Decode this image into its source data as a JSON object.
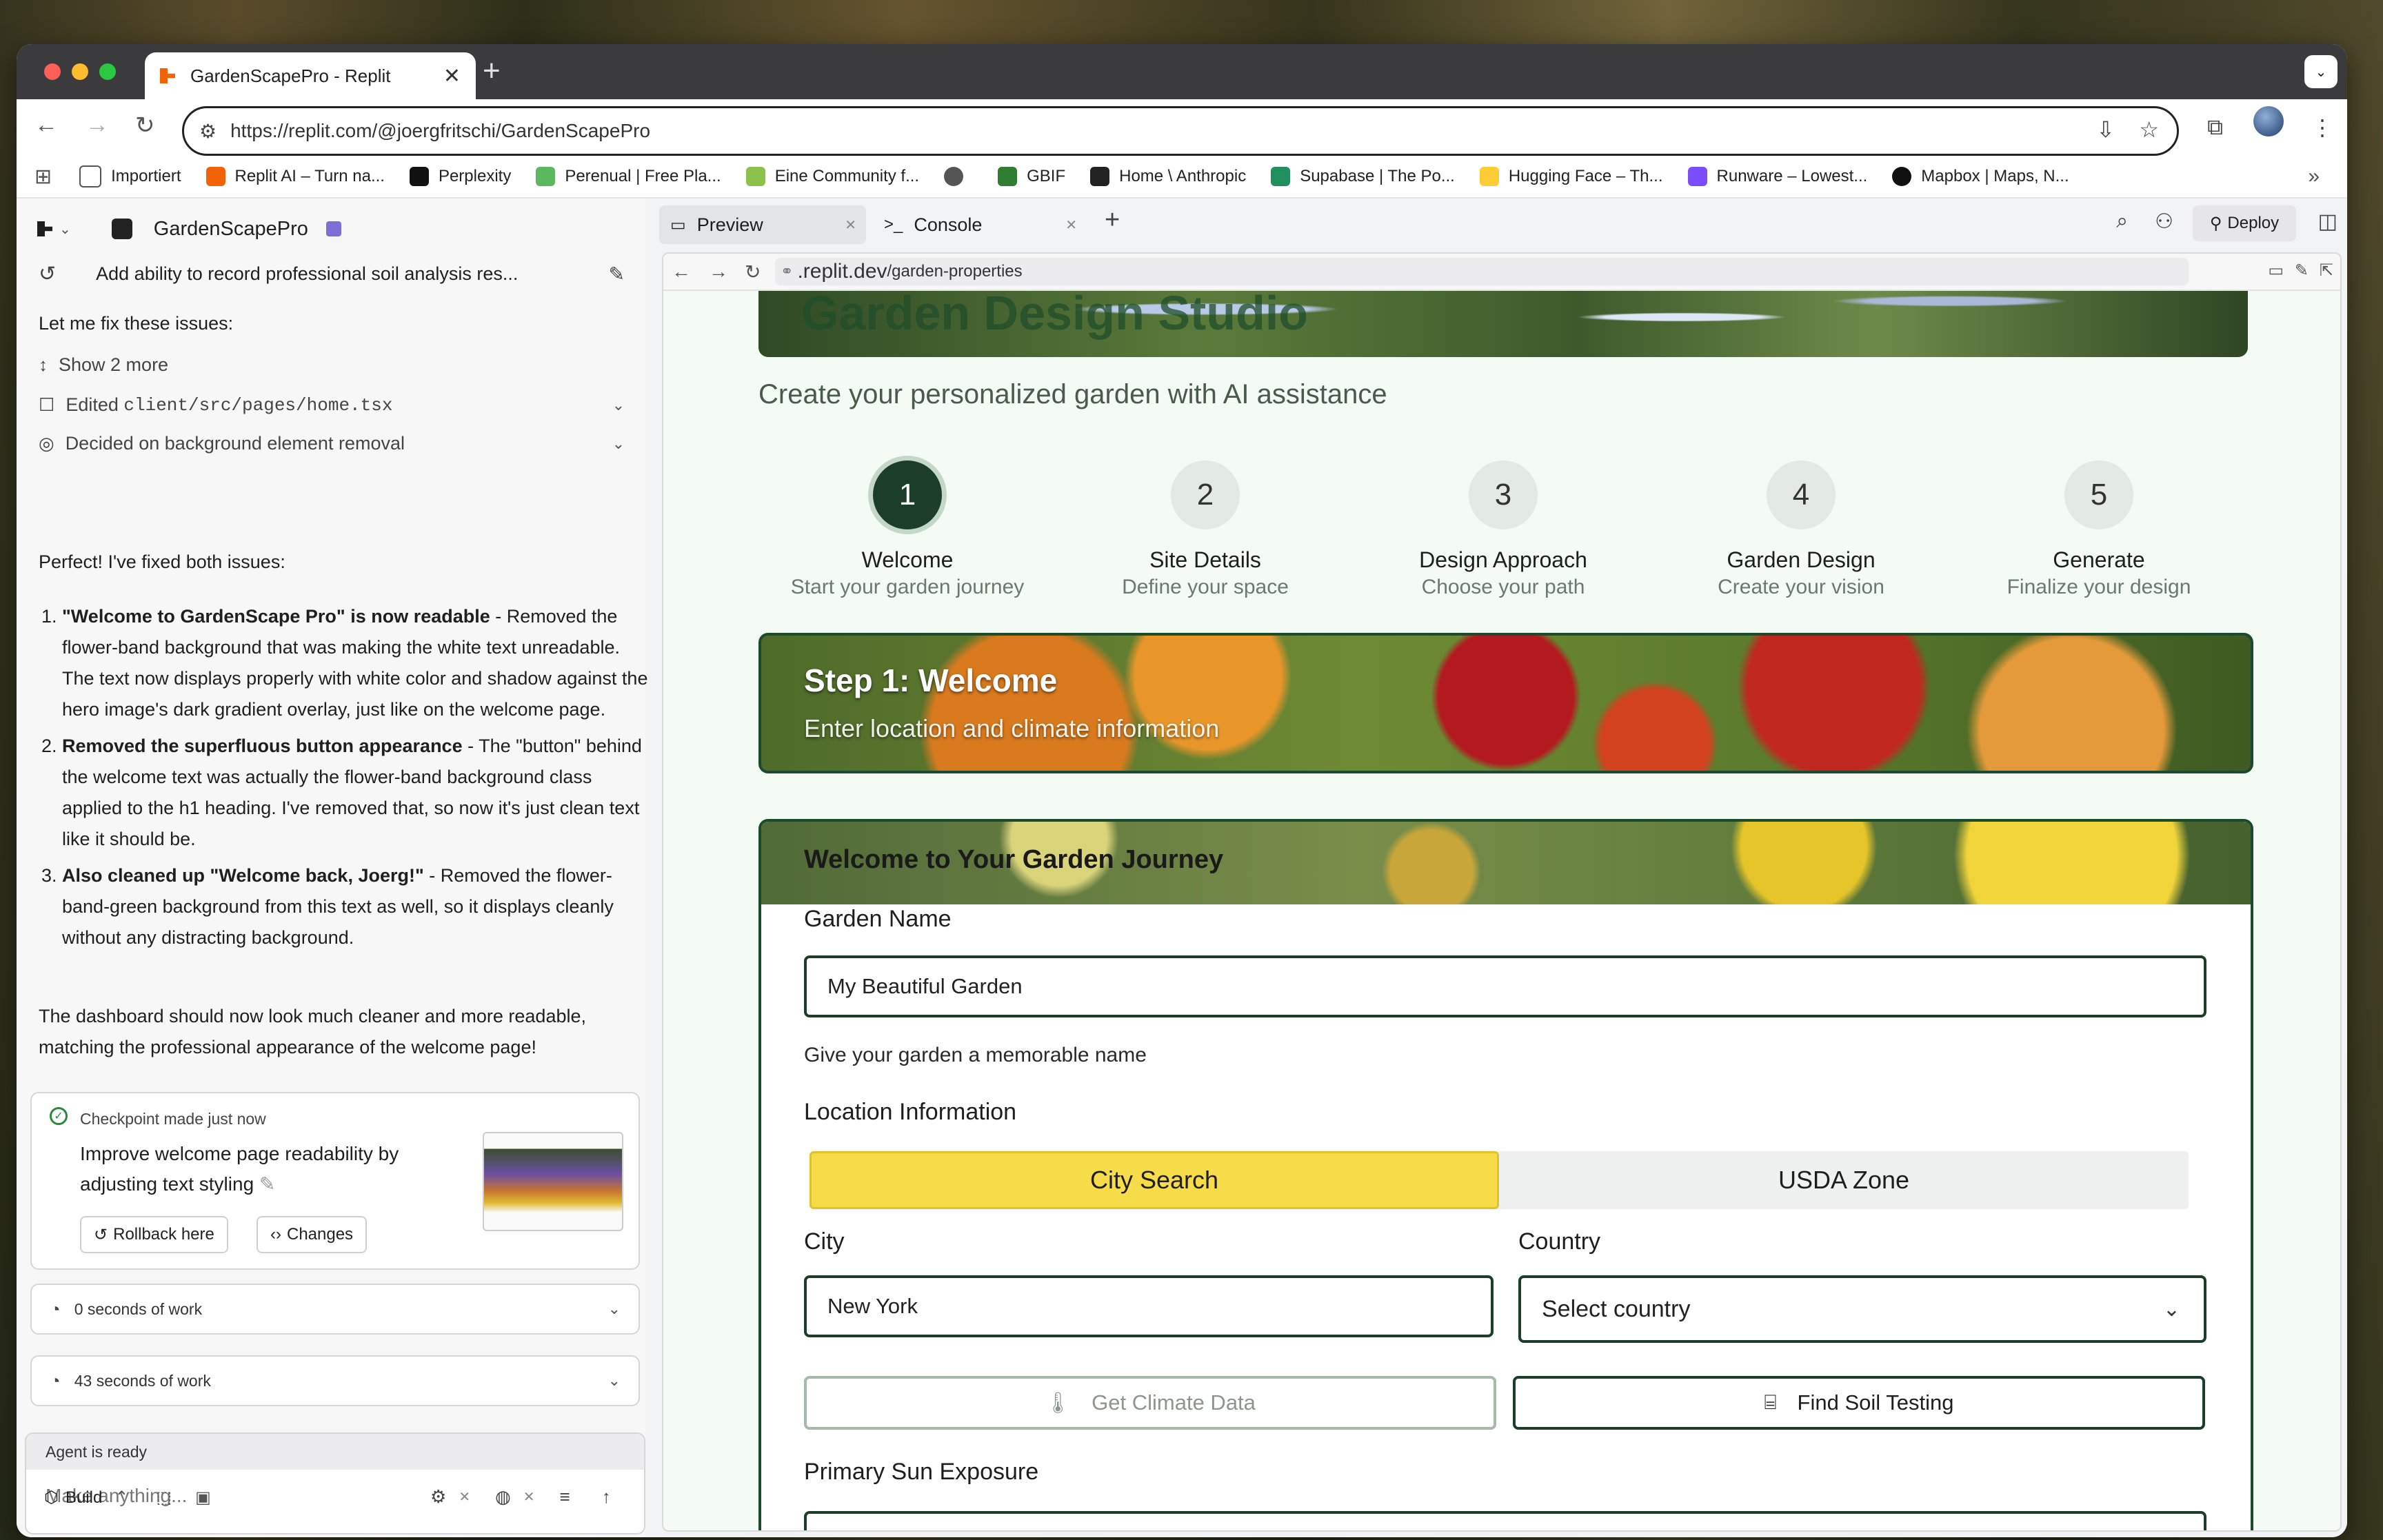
{
  "browser": {
    "tab_title": "GardenScapePro - Replit",
    "url": "https://replit.com/@joergfritschi/GardenScapePro",
    "bookmarks": [
      "Importiert",
      "Replit AI – Turn na...",
      "Perplexity",
      "Perenual | Free Pla...",
      "Eine Community f...",
      "",
      "GBIF",
      "Home \\ Anthropic",
      "Supabase | The Po...",
      "Hugging Face – Th...",
      "Runware – Lowest...",
      "Mapbox | Maps, N..."
    ]
  },
  "workspace": {
    "project_name": "GardenScapePro",
    "tabs": {
      "preview": "Preview",
      "console": "Console"
    },
    "deploy_label": "Deploy"
  },
  "agent": {
    "thread_title": "Add ability to record professional soil analysis res...",
    "intro": "Let me fix these issues:",
    "show_more": "Show 2 more",
    "edited_prefix": "Edited",
    "edited_file": "client/src/pages/home.tsx",
    "decided": "Decided on background element removal",
    "summary": "Perfect! I've fixed both issues:",
    "fixes": [
      {
        "bold": "\"Welcome to GardenScape Pro\" is now readable",
        "text": " - Removed the flower-band background that was making the white text unreadable. The text now displays properly with white color and shadow against the hero image's dark gradient overlay, just like on the welcome page."
      },
      {
        "bold": "Removed the superfluous button appearance",
        "text": " - The \"button\" behind the welcome text was actually the flower-band background class applied to the h1 heading. I've removed that, so now it's just clean text like it should be."
      },
      {
        "bold": "Also cleaned up \"Welcome back, Joerg!\"",
        "text": " - Removed the flower-band-green background from this text as well, so it displays cleanly without any distracting background."
      }
    ],
    "closing": "The dashboard should now look much cleaner and more readable, matching the professional appearance of the welcome page!",
    "checkpoint": {
      "title": "Checkpoint made just now",
      "description": "Improve welcome page readability by adjusting text styling",
      "rollback": "Rollback here",
      "changes": "Changes"
    },
    "work_items": [
      "0 seconds of work",
      "43 seconds of work"
    ],
    "status": "Agent is ready",
    "input_placeholder": "Make anything...",
    "build_label": "Build"
  },
  "preview": {
    "url_prefix": ".replit.dev",
    "url_path": "/garden-properties",
    "page_heading": "Garden Design Studio",
    "subtitle": "Create your personalized garden with AI assistance",
    "steps": [
      {
        "num": "1",
        "title": "Welcome",
        "sub": "Start your garden journey"
      },
      {
        "num": "2",
        "title": "Site Details",
        "sub": "Define your space"
      },
      {
        "num": "3",
        "title": "Design Approach",
        "sub": "Choose your path"
      },
      {
        "num": "4",
        "title": "Garden Design",
        "sub": "Create your vision"
      },
      {
        "num": "5",
        "title": "Generate",
        "sub": "Finalize your design"
      }
    ],
    "step_banner": {
      "title": "Step 1: Welcome",
      "sub": "Enter location and climate information"
    },
    "card_title": "Welcome to Your Garden Journey",
    "garden_name_label": "Garden Name",
    "garden_name_value": "My Beautiful Garden",
    "garden_name_help": "Give your garden a memorable name",
    "location_label": "Location Information",
    "seg": {
      "city": "City Search",
      "usda": "USDA Zone"
    },
    "city_label": "City",
    "city_value": "New York",
    "country_label": "Country",
    "country_value": "Select country",
    "climate_btn": "Get Climate Data",
    "soil_btn": "Find Soil Testing",
    "sun_label": "Primary Sun Exposure"
  },
  "colors": {
    "accent": "#1c3d2a",
    "segment_active": "#f7dc4a",
    "replit_orange": "#f26207"
  }
}
